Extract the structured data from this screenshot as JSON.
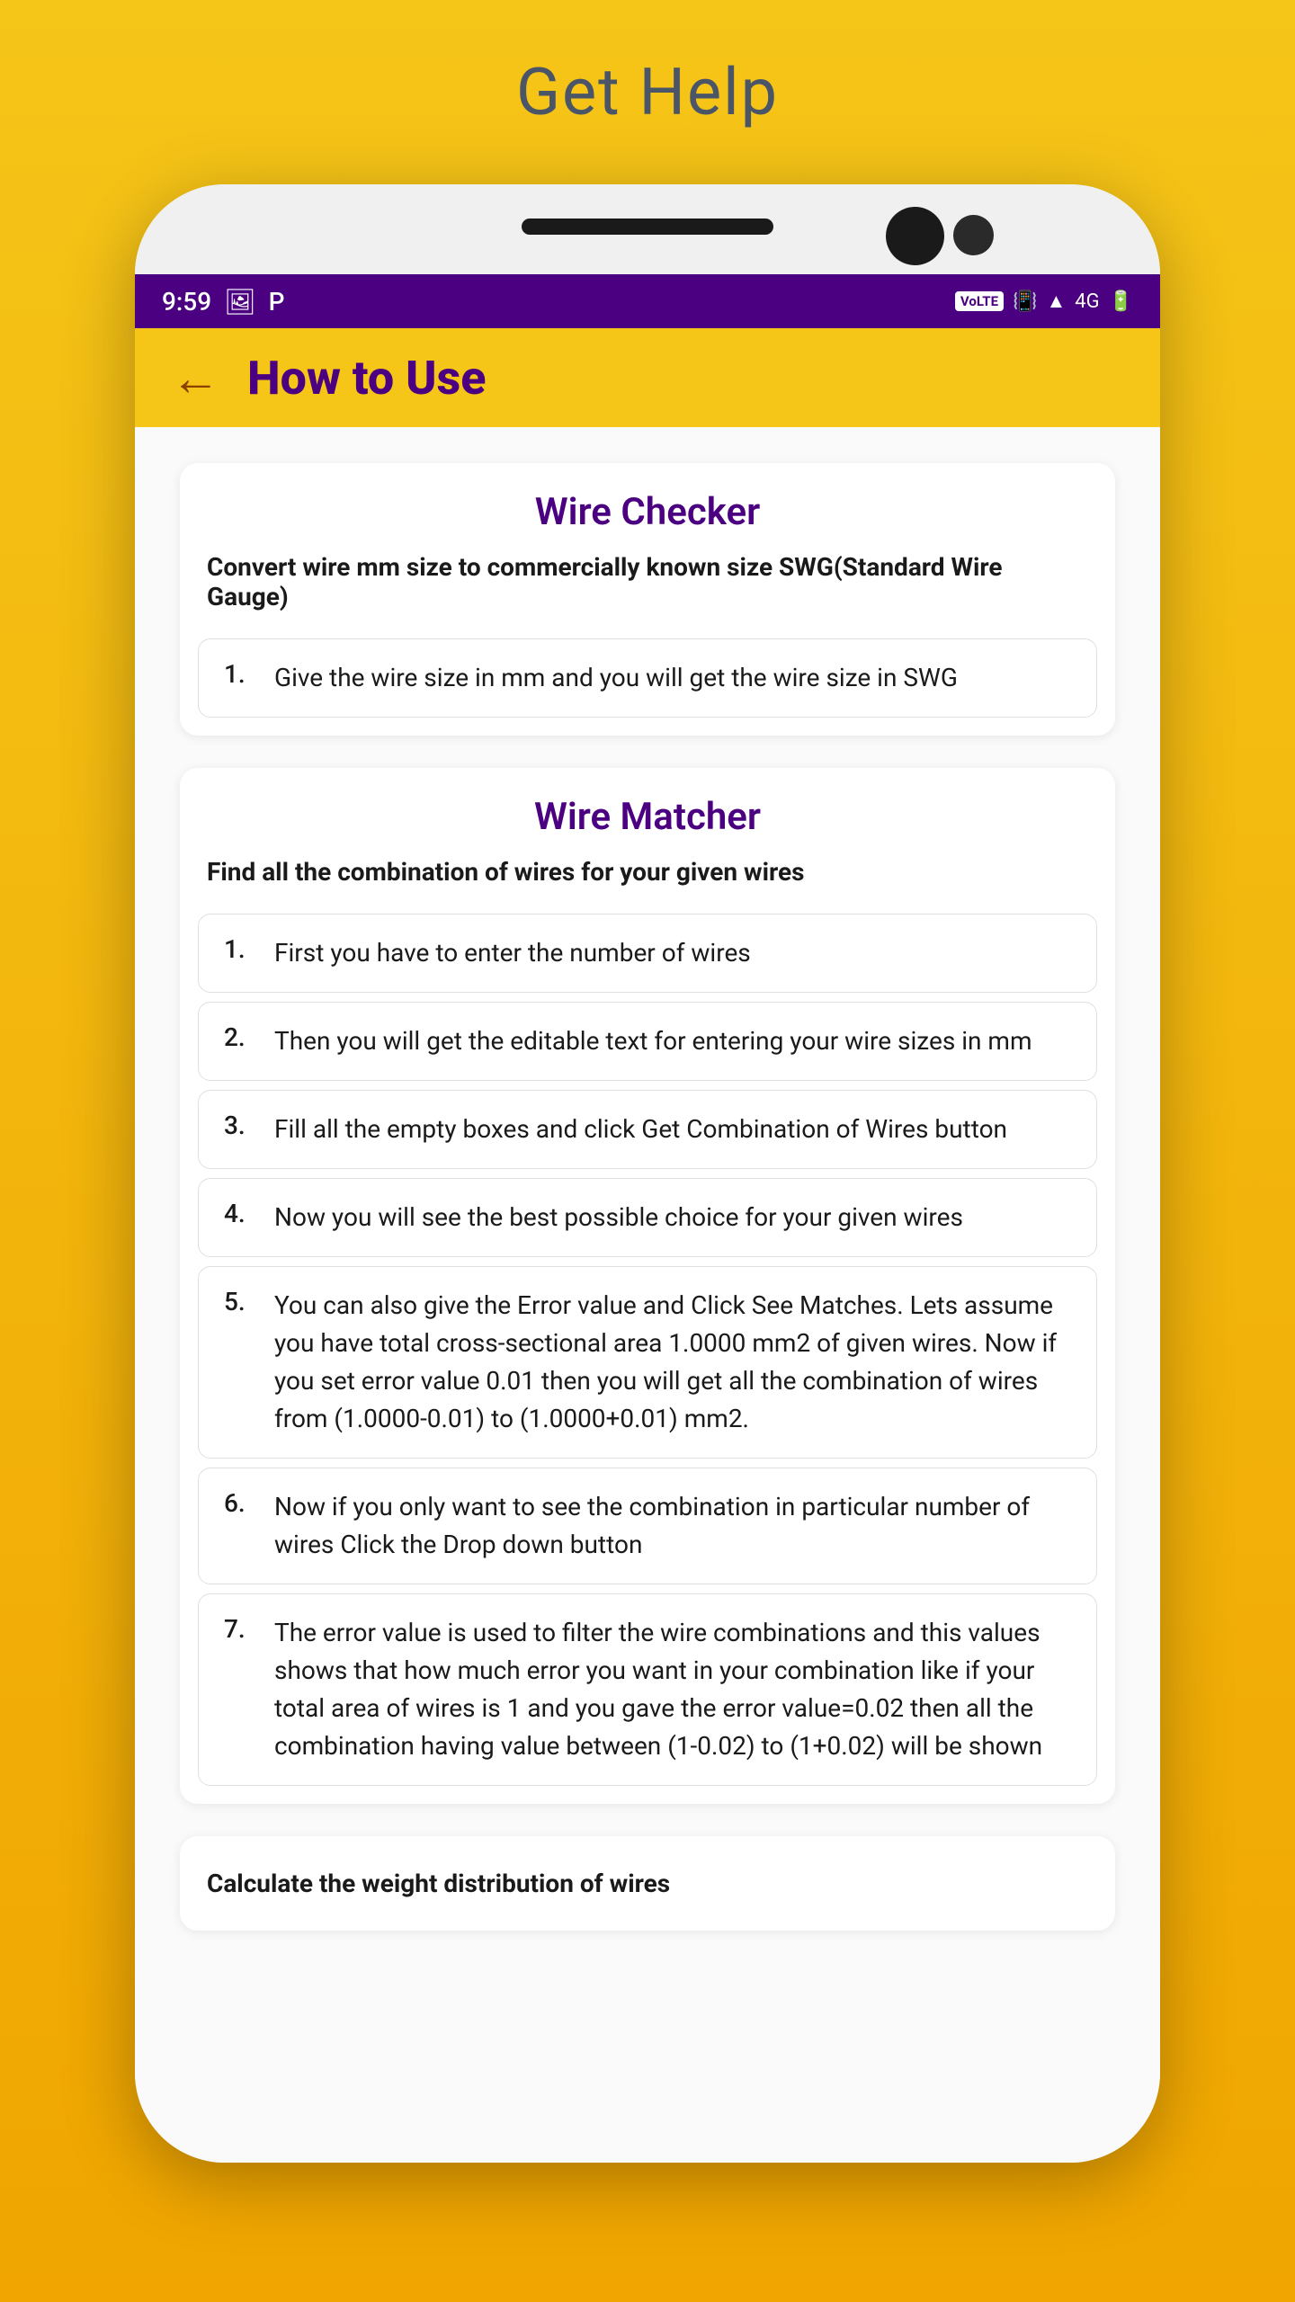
{
  "page": {
    "title": "Get Help"
  },
  "status_bar": {
    "time": "9:59",
    "volte": "VoLTE",
    "icons": [
      "📷",
      "P"
    ]
  },
  "header": {
    "back_label": "←",
    "title": "How to Use"
  },
  "wire_checker": {
    "title": "Wire Checker",
    "subtitle": "Convert wire mm size to commercially known size SWG(Standard Wire Gauge)",
    "instructions": [
      {
        "num": "1.",
        "text": "Give the wire size in mm and you will get the wire size in SWG"
      }
    ]
  },
  "wire_matcher": {
    "title": "Wire Matcher",
    "subtitle": "Find all the combination of wires for your given wires",
    "instructions": [
      {
        "num": "1.",
        "text": "First you have to enter the number of wires"
      },
      {
        "num": "2.",
        "text": "Then you will get the editable text for entering your wire sizes in mm"
      },
      {
        "num": "3.",
        "text": "Fill all the empty boxes and click Get Combination of Wires button"
      },
      {
        "num": "4.",
        "text": "Now you will see the best possible choice for your given wires"
      },
      {
        "num": "5.",
        "text": "You can also give the Error value and Click See Matches. Lets assume you have total cross-sectional area 1.0000 mm2 of given wires. Now if you set error value 0.01 then you will get all the combination of wires from (1.0000-0.01) to (1.0000+0.01) mm2."
      },
      {
        "num": "6.",
        "text": "Now if you only want to see the combination in particular number of wires Click the Drop down button"
      },
      {
        "num": "7.",
        "text": "The error value is used to filter the wire combinations and this values shows that how much error you want in your combination like if your total area of wires is 1 and you gave the error value=0.02 then all the combination having value between (1-0.02) to (1+0.02) will be shown"
      }
    ]
  },
  "weight_distribution": {
    "subtitle": "Calculate the weight distribution of wires"
  }
}
